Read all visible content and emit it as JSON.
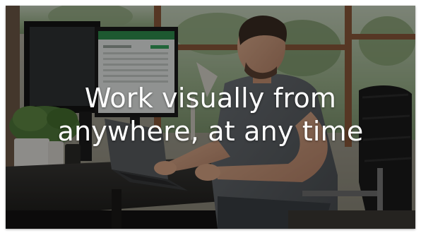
{
  "hero": {
    "headline_line1": "Work visually from",
    "headline_line2": "anywhere, at any time"
  },
  "colors": {
    "overlay": "#000000",
    "headline_text": "#ffffff"
  }
}
